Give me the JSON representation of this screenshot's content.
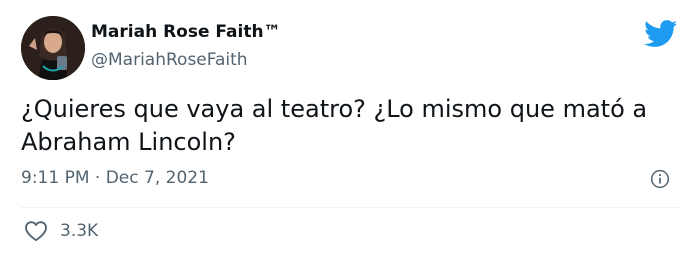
{
  "author": {
    "display_name": "Mariah Rose Faith™",
    "handle": "@MariahRoseFaith"
  },
  "tweet": {
    "text": "¿Quieres que vaya al teatro? ¿Lo mismo que mató a Abraham Lincoln?",
    "timestamp": "9:11 PM · Dec 7, 2021",
    "like_count": "3.3K"
  },
  "icons": {
    "brand": "twitter-bird-icon",
    "info": "info-icon",
    "like": "heart-icon"
  },
  "colors": {
    "brand": "#1d9bf0",
    "text_primary": "#0f1419",
    "text_secondary": "#536471"
  }
}
